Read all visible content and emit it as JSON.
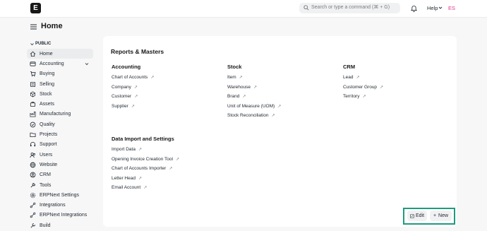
{
  "navbar": {
    "logo_letter": "E",
    "search_placeholder": "Search or type a command (⌘ + G)",
    "help_label": "Help",
    "avatar_initials": "ES"
  },
  "page": {
    "title": "Home"
  },
  "sidebar": {
    "section_label": "PUBLIC",
    "items": [
      {
        "label": "Home",
        "icon": "home-icon",
        "active": true
      },
      {
        "label": "Accounting",
        "icon": "accounting-icon"
      },
      {
        "label": "Buying",
        "icon": "cart-icon"
      },
      {
        "label": "Selling",
        "icon": "selling-icon"
      },
      {
        "label": "Stock",
        "icon": "box-icon"
      },
      {
        "label": "Assets",
        "icon": "assets-icon"
      },
      {
        "label": "Manufacturing",
        "icon": "factory-icon"
      },
      {
        "label": "Quality",
        "icon": "quality-icon"
      },
      {
        "label": "Projects",
        "icon": "folder-icon"
      },
      {
        "label": "Support",
        "icon": "support-icon"
      },
      {
        "label": "Users",
        "icon": "users-icon"
      },
      {
        "label": "Website",
        "icon": "globe-icon"
      },
      {
        "label": "CRM",
        "icon": "crm-icon"
      },
      {
        "label": "Tools",
        "icon": "tools-icon"
      },
      {
        "label": "ERPNext Settings",
        "icon": "settings-icon"
      },
      {
        "label": "Integrations",
        "icon": "integrations-icon"
      },
      {
        "label": "ERPNext Integrations",
        "icon": "integrations-icon"
      },
      {
        "label": "Build",
        "icon": "build-icon"
      }
    ]
  },
  "card": {
    "title": "Reports & Masters",
    "groups": [
      {
        "title": "Accounting",
        "links": [
          "Chart of Accounts",
          "Company",
          "Customer",
          "Supplier"
        ]
      },
      {
        "title": "Stock",
        "links": [
          "Item",
          "Warehouse",
          "Brand",
          "Unit of Measure (UOM)",
          "Stock Reconciliation"
        ]
      },
      {
        "title": "CRM",
        "links": [
          "Lead",
          "Customer Group",
          "Territory"
        ]
      },
      {
        "title": "Data Import and Settings",
        "links": [
          "Import Data",
          "Opening Invoice Creation Tool",
          "Chart of Accounts Importer",
          "Letter Head",
          "Email Account"
        ]
      }
    ]
  },
  "actions": {
    "edit_label": "Edit",
    "new_label": "New"
  },
  "colors": {
    "highlight": "#1f9a7e",
    "avatar": "#e0388a"
  }
}
